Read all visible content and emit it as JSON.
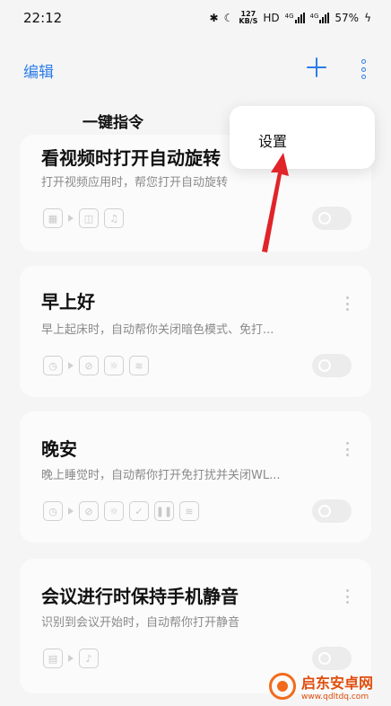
{
  "status": {
    "time": "22:12",
    "speed_top": "127",
    "speed_unit": "KB/S",
    "hd": "HD",
    "net1": "4G",
    "net2": "4G",
    "battery": "57%"
  },
  "header": {
    "edit_label": "编辑"
  },
  "section": {
    "title": "一键指令"
  },
  "popup": {
    "item": "设置"
  },
  "cards": [
    {
      "title": "看视频时打开自动旋转",
      "desc": "打开视频应用时，帮您打开自动旋转"
    },
    {
      "title": "早上好",
      "desc": "早上起床时，自动帮你关闭暗色模式、免打..."
    },
    {
      "title": "晚安",
      "desc": "晚上睡觉时，自动帮你打开免打扰并关闭WL..."
    },
    {
      "title": "会议进行时保持手机静音",
      "desc": "识别到会议开始时，自动帮你打开静音"
    }
  ],
  "watermark": {
    "name": "启东安卓网",
    "url": "www.qdltdq.com"
  },
  "colors": {
    "accent": "#2b7de9",
    "annotation_arrow": "#e0242a"
  }
}
